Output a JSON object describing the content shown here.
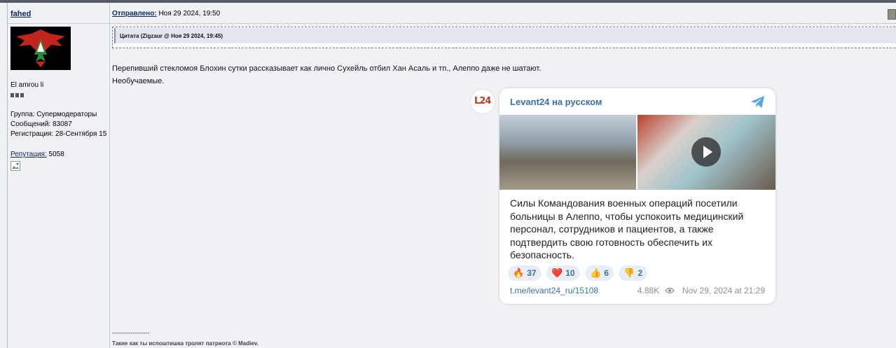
{
  "user": {
    "name": "fahed",
    "title": "El amrou li",
    "group": "Группа: Супермодераторы",
    "posts": "Сообщений: 83087",
    "registered": "Регистрация: 28-Сентября 15",
    "reputation_label": "Репутация:",
    "reputation_value": "5058"
  },
  "post": {
    "sent_label": "Отправлено:",
    "sent_date": "Ноя 29 2024, 19:50",
    "quote_header": "Цитата (Zigzaur @ Ноя 29 2024, 19:45)",
    "line1": "Перепивший стекломоя Блохин сутки рассказывает как лично Сухейль отбил Хан Асаль и тп., Алеппо даже не шатают.",
    "line2": "Необучаемые.",
    "signature_rule": "--------------------",
    "signature": "Такие как ты испоштишка тролят патриота © Madiev."
  },
  "telegram": {
    "avatar_text": "L24",
    "channel": "Levant24 на русском",
    "text": "Силы Командования военных операций посетили больницы в Алеппо, чтобы успокоить медицинский персонал, сотрудников и пациентов, а также подтвердить свою готовность обеспечить их безопасность.",
    "reactions": [
      {
        "emoji": "🔥",
        "count": "37"
      },
      {
        "emoji": "❤️",
        "count": "10"
      },
      {
        "emoji": "👍",
        "count": "6"
      },
      {
        "emoji": "👎",
        "count": "2"
      }
    ],
    "link": "t.me/levant24_ru/15108",
    "views": "4.88K",
    "date": "Nov 29, 2024 at 21:29"
  },
  "colors": {
    "link": "#0b2a63",
    "telegram_blue": "#3a6fa8"
  },
  "icons": [
    "avatar-emblem-icon",
    "telegram-icon",
    "play-icon",
    "eye-icon",
    "report-icon",
    "broken-image-icon"
  ]
}
